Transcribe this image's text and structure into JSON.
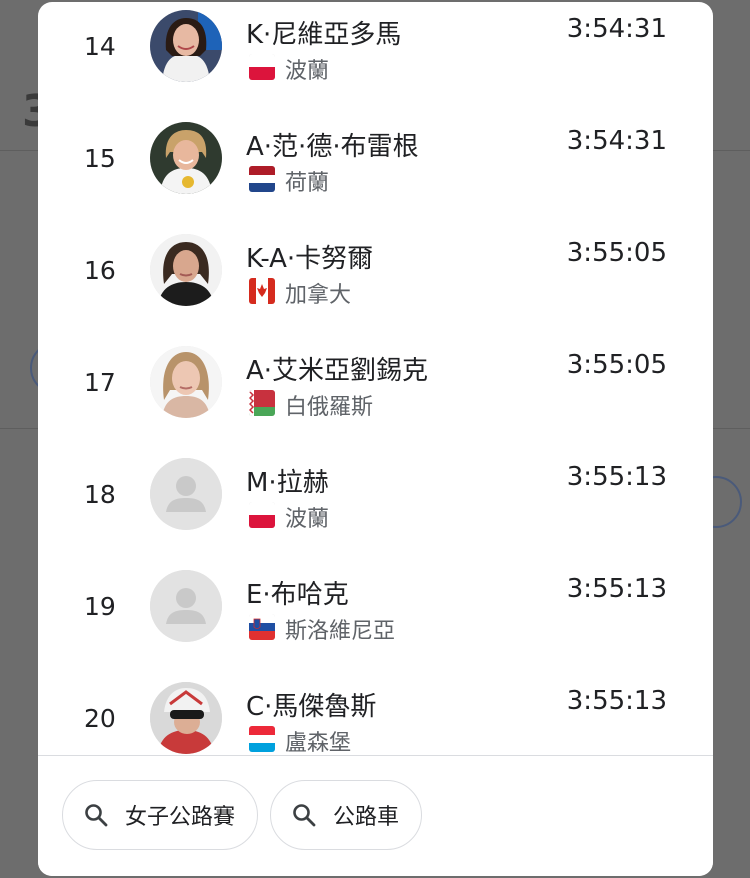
{
  "results": [
    {
      "rank": "14",
      "name": "K·尼維亞多馬",
      "time": "3:54:31",
      "country": "波蘭",
      "flag": "poland",
      "avatar": "photo"
    },
    {
      "rank": "15",
      "name": "A·范·德·布雷根",
      "time": "3:54:31",
      "country": "荷蘭",
      "flag": "netherlands",
      "avatar": "photo"
    },
    {
      "rank": "16",
      "name": "K-A·卡努爾",
      "time": "3:55:05",
      "country": "加拿大",
      "flag": "canada",
      "avatar": "photo"
    },
    {
      "rank": "17",
      "name": "A·艾米亞劉錫克",
      "time": "3:55:05",
      "country": "白俄羅斯",
      "flag": "belarus",
      "avatar": "photo"
    },
    {
      "rank": "18",
      "name": "M·拉赫",
      "time": "3:55:13",
      "country": "波蘭",
      "flag": "poland",
      "avatar": "placeholder"
    },
    {
      "rank": "19",
      "name": "E·布哈克",
      "time": "3:55:13",
      "country": "斯洛維尼亞",
      "flag": "slovenia",
      "avatar": "placeholder"
    },
    {
      "rank": "20",
      "name": "C·馬傑魯斯",
      "time": "3:55:13",
      "country": "盧森堡",
      "flag": "luxembourg",
      "avatar": "photo"
    }
  ],
  "related_searches": [
    {
      "label": "女子公路賽",
      "icon": "search-icon"
    },
    {
      "label": "公路車",
      "icon": "search-icon"
    }
  ],
  "colors": {
    "text": "#202124",
    "secondary": "#5f6368",
    "chip_border": "#dadce0",
    "placeholder_avatar": "#e3e3e3"
  }
}
